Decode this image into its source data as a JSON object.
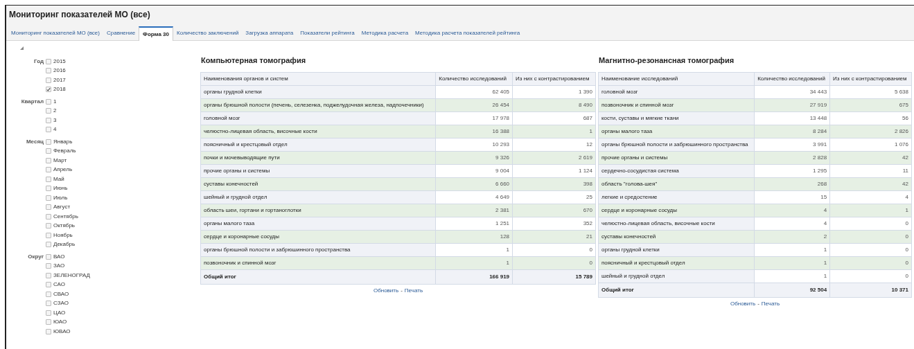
{
  "window": {
    "title": "Мониторинг показателей МО (все)"
  },
  "tabs": [
    {
      "label": "Мониторинг показателей МО (все)",
      "selected": false
    },
    {
      "label": "Сравнение",
      "selected": false
    },
    {
      "label": "Форма 30",
      "selected": true
    },
    {
      "label": "Количество заключений",
      "selected": false
    },
    {
      "label": "Загрузка аппарата",
      "selected": false
    },
    {
      "label": "Показатели рейтинга",
      "selected": false
    },
    {
      "label": "Методика расчета",
      "selected": false
    },
    {
      "label": "Методика расчета показателей рейтинга",
      "selected": false
    }
  ],
  "filters": [
    {
      "label": "Год",
      "options": [
        {
          "label": "2015",
          "checked": false
        },
        {
          "label": "2016",
          "checked": false
        },
        {
          "label": "2017",
          "checked": false
        },
        {
          "label": "2018",
          "checked": true
        }
      ]
    },
    {
      "label": "Квартал",
      "options": [
        {
          "label": "1",
          "checked": false
        },
        {
          "label": "2",
          "checked": false
        },
        {
          "label": "3",
          "checked": false
        },
        {
          "label": "4",
          "checked": false
        }
      ]
    },
    {
      "label": "Месяц",
      "options": [
        {
          "label": "Январь",
          "checked": false
        },
        {
          "label": "Февраль",
          "checked": false
        },
        {
          "label": "Март",
          "checked": false
        },
        {
          "label": "Апрель",
          "checked": false
        },
        {
          "label": "Май",
          "checked": false
        },
        {
          "label": "Июнь",
          "checked": false
        },
        {
          "label": "Июль",
          "checked": false
        },
        {
          "label": "Август",
          "checked": false
        },
        {
          "label": "Сентябрь",
          "checked": false
        },
        {
          "label": "Октябрь",
          "checked": false
        },
        {
          "label": "Ноябрь",
          "checked": false
        },
        {
          "label": "Декабрь",
          "checked": false
        }
      ]
    },
    {
      "label": "Округ",
      "options": [
        {
          "label": "ВАО",
          "checked": false
        },
        {
          "label": "ЗАО",
          "checked": false
        },
        {
          "label": "ЗЕЛЕНОГРАД",
          "checked": false
        },
        {
          "label": "САО",
          "checked": false
        },
        {
          "label": "СВАО",
          "checked": false
        },
        {
          "label": "СЗАО",
          "checked": false
        },
        {
          "label": "ЦАО",
          "checked": false
        },
        {
          "label": "ЮАО",
          "checked": false
        },
        {
          "label": "ЮВАО",
          "checked": false
        }
      ]
    }
  ],
  "tables": [
    {
      "title": "Компьютерная томография",
      "columns": [
        "Наименования органов и систем",
        "Количество исследований",
        "Из них с контрастированием"
      ],
      "rows": [
        {
          "name": "органы грудной клетки",
          "values": [
            "62 405",
            "1 390"
          ]
        },
        {
          "name": "органы брюшной полости (печень, селезенка, поджелудочная железа, надпочечники)",
          "values": [
            "26 454",
            "8 490"
          ]
        },
        {
          "name": "головной мозг",
          "values": [
            "17 978",
            "687"
          ]
        },
        {
          "name": "челюстно-лицевая область, височные кости",
          "values": [
            "16 388",
            "1"
          ]
        },
        {
          "name": "поясничный и крестцовый отдел",
          "values": [
            "10 293",
            "12"
          ]
        },
        {
          "name": "почки и мочевыводящие пути",
          "values": [
            "9 326",
            "2 619"
          ]
        },
        {
          "name": "прочие органы и системы",
          "values": [
            "9 004",
            "1 124"
          ]
        },
        {
          "name": "суставы конечностей",
          "values": [
            "6 660",
            "398"
          ]
        },
        {
          "name": "шейный и грудной отдел",
          "values": [
            "4 649",
            "25"
          ]
        },
        {
          "name": "область шеи, гортани и гортаноглотки",
          "values": [
            "2 381",
            "670"
          ]
        },
        {
          "name": "органы малого таза",
          "values": [
            "1 251",
            "352"
          ]
        },
        {
          "name": "сердце и коронарные сосуды",
          "values": [
            "128",
            "21"
          ]
        },
        {
          "name": "органы брюшной полости и забрюшинного пространства",
          "values": [
            "1",
            "0"
          ]
        },
        {
          "name": "позвоночник и спинной мозг",
          "values": [
            "1",
            "0"
          ]
        }
      ],
      "total": {
        "name": "Общий итог",
        "values": [
          "166 919",
          "15 789"
        ]
      },
      "links": [
        "Обновить",
        "Печать"
      ],
      "separator": "-"
    },
    {
      "title": "Магнитно-резонансная томография",
      "columns": [
        "Наименование исследований",
        "Количество исследований",
        "Из них с контрастированием"
      ],
      "rows": [
        {
          "name": "головной мозг",
          "values": [
            "34 443",
            "5 638"
          ]
        },
        {
          "name": "позвоночник и спинной мозг",
          "values": [
            "27 919",
            "675"
          ]
        },
        {
          "name": "кости, суставы и мягкие ткани",
          "values": [
            "13 448",
            "56"
          ]
        },
        {
          "name": "органы малого таза",
          "values": [
            "8 284",
            "2 826"
          ]
        },
        {
          "name": "органы брюшной полости и забрюшинного пространства",
          "values": [
            "3 991",
            "1 076"
          ]
        },
        {
          "name": "прочие органы и системы",
          "values": [
            "2 828",
            "42"
          ]
        },
        {
          "name": "сердечно-сосудистая система",
          "values": [
            "1 295",
            "11"
          ]
        },
        {
          "name": "область \"голова-шея\"",
          "values": [
            "268",
            "42"
          ]
        },
        {
          "name": "легкие и средостение",
          "values": [
            "15",
            "4"
          ]
        },
        {
          "name": "сердце и коронарные сосуды",
          "values": [
            "4",
            "1"
          ]
        },
        {
          "name": "челюстно-лицевая область, височные кости",
          "values": [
            "4",
            "0"
          ]
        },
        {
          "name": "суставы конечностей",
          "values": [
            "2",
            "0"
          ]
        },
        {
          "name": "органы грудной клетки",
          "values": [
            "1",
            "0"
          ]
        },
        {
          "name": "поясничный и крестцовый отдел",
          "values": [
            "1",
            "0"
          ]
        },
        {
          "name": "шейный и грудной отдел",
          "values": [
            "1",
            "0"
          ]
        }
      ],
      "total": {
        "name": "Общий итог",
        "values": [
          "92 504",
          "10 371"
        ]
      },
      "links": [
        "Обновить",
        "Печать"
      ],
      "separator": "-"
    }
  ]
}
